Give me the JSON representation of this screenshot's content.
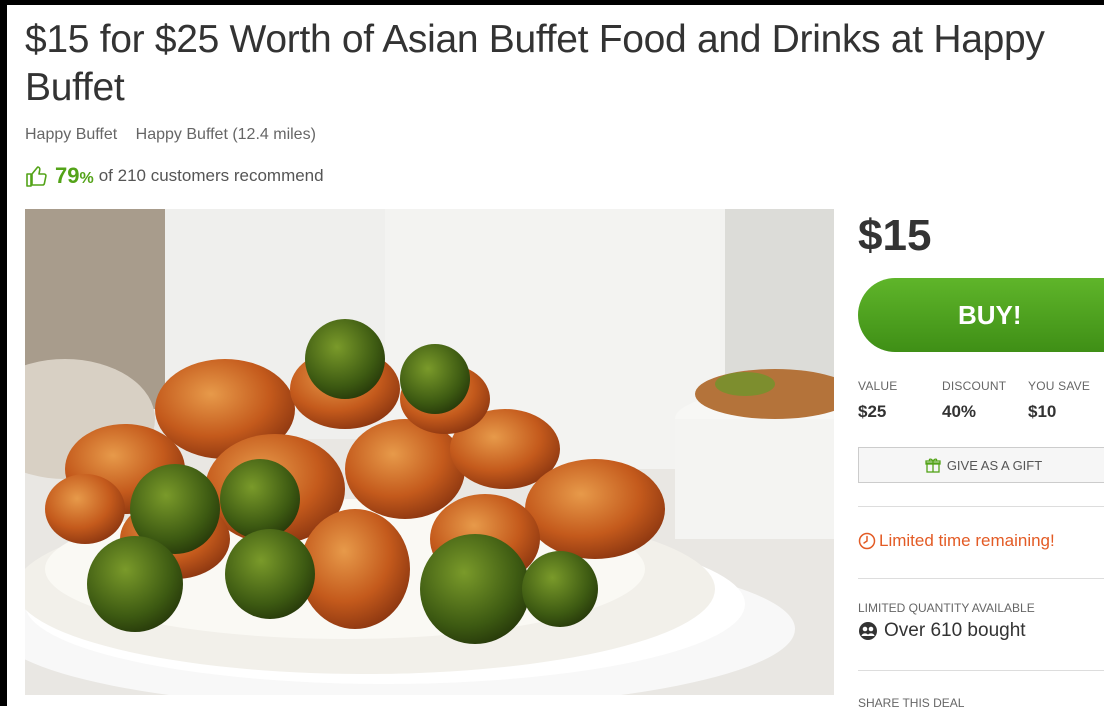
{
  "deal": {
    "title": "$15 for $25 Worth of Asian Buffet Food and Drinks at Happy Buffet",
    "merchant": "Happy Buffet",
    "location": "Happy Buffet (12.4 miles)",
    "recommend_pct": "79",
    "recommend_pct_sign": "%",
    "recommend_text": "of 210 customers recommend"
  },
  "sidebar": {
    "price": "$15",
    "buy_label": "BUY!",
    "stats": [
      {
        "label": "VALUE",
        "value": "$25"
      },
      {
        "label": "DISCOUNT",
        "value": "40%"
      },
      {
        "label": "YOU SAVE",
        "value": "$10"
      }
    ],
    "gift_label": "GIVE AS A GIFT",
    "limited_time": "Limited time remaining!",
    "quantity_label": "LIMITED QUANTITY AVAILABLE",
    "bought_text": "Over 610 bought",
    "share_label": "SHARE THIS DEAL"
  },
  "colors": {
    "accent_green": "#53a318",
    "urgency_orange": "#e35b25"
  },
  "icons": {
    "thumb": "thumbs-up-icon",
    "gift": "gift-icon",
    "clock": "clock-icon",
    "bought": "people-icon"
  }
}
